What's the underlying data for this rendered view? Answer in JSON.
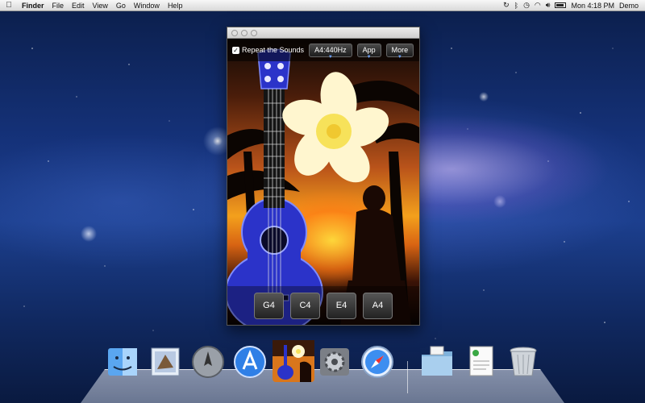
{
  "menubar": {
    "apple_icon": "apple-icon",
    "items": [
      "Finder",
      "File",
      "Edit",
      "View",
      "Go",
      "Window",
      "Help"
    ],
    "clock": "Mon 4:18 PM",
    "user": "Demo"
  },
  "window": {
    "toolbar": {
      "repeat_label": "Repeat the Sounds",
      "repeat_checked": "✓",
      "tuning_button": "A4:440Hz",
      "app_button": "App",
      "more_button": "More"
    },
    "strings": [
      "G4",
      "C4",
      "E4",
      "A4"
    ]
  },
  "dock": {
    "items": [
      "finder-icon",
      "mail-icon",
      "launchpad-icon",
      "app-store-icon",
      "ukulele-app-icon",
      "system-preferences-icon",
      "safari-icon",
      "downloads-folder-icon",
      "document-icon",
      "trash-icon"
    ]
  },
  "colors": {
    "ukulele_blue": "#2b33c9",
    "flower": "#f7e25a",
    "sunset": "#f3a01c"
  }
}
